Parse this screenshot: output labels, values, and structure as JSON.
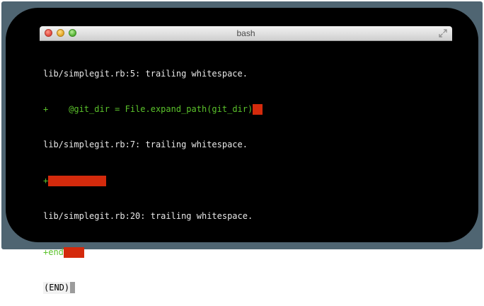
{
  "window": {
    "title": "bash"
  },
  "terminal": {
    "lines": [
      {
        "text": "lib/simplegit.rb:5: trailing whitespace."
      },
      {
        "prefix": "+",
        "text": "    @git_dir = File.expand_path(git_dir)"
      },
      {
        "text": "lib/simplegit.rb:7: trailing whitespace."
      },
      {
        "prefix": "+"
      },
      {
        "text": "lib/simplegit.rb:20: trailing whitespace."
      },
      {
        "prefix": "+",
        "text": "end"
      },
      {
        "prompt": "(END)"
      }
    ]
  },
  "colors": {
    "frame": "#4f6572",
    "terminal_background": "#000000",
    "header_text": "#e8e8e8",
    "added_line": "#5bc22b",
    "whitespace_highlight": "#d42a0c"
  },
  "icons": {
    "close": "close-button-icon",
    "minimize": "minimize-button-icon",
    "zoom": "zoom-button-icon",
    "fullscreen": "fullscreen-arrows-icon"
  }
}
